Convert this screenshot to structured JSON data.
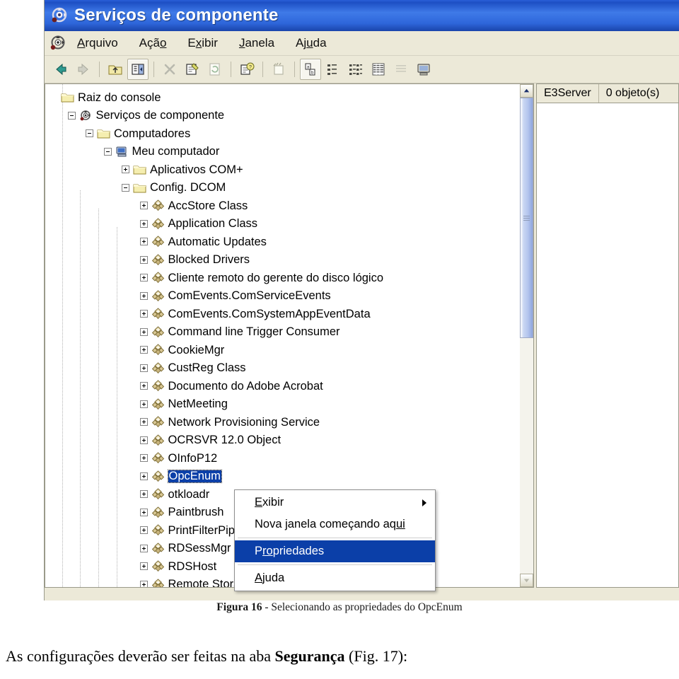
{
  "window": {
    "title": "Serviços de componente",
    "title_icon": "component-services-icon",
    "menu_icon": "component-services-icon"
  },
  "menubar": {
    "items": [
      {
        "name": "menu-arquivo",
        "pre": "",
        "acc": "A",
        "post": "rquivo"
      },
      {
        "name": "menu-acao",
        "pre": "Açã",
        "acc": "o",
        "post": ""
      },
      {
        "name": "menu-exibir",
        "pre": "E",
        "acc": "x",
        "post": "ibir"
      },
      {
        "name": "menu-janela",
        "pre": "",
        "acc": "J",
        "post": "anela"
      },
      {
        "name": "menu-ajuda",
        "pre": "Aj",
        "acc": "u",
        "post": "da"
      }
    ]
  },
  "toolbar": {
    "buttons": [
      {
        "name": "back-icon",
        "glyph": "back"
      },
      {
        "name": "forward-icon",
        "glyph": "forward"
      },
      {
        "name": "sep",
        "glyph": "sep"
      },
      {
        "name": "up-one-level-icon",
        "glyph": "up-folder"
      },
      {
        "name": "show-hide-console-tree-icon",
        "glyph": "tree-pane",
        "pressed": true
      },
      {
        "name": "sep",
        "glyph": "sep"
      },
      {
        "name": "delete-icon",
        "glyph": "delete"
      },
      {
        "name": "properties-icon",
        "glyph": "properties"
      },
      {
        "name": "refresh-icon",
        "glyph": "refresh"
      },
      {
        "name": "sep",
        "glyph": "sep"
      },
      {
        "name": "help-icon",
        "glyph": "help"
      },
      {
        "name": "sep",
        "glyph": "sep"
      },
      {
        "name": "new-object-icon",
        "glyph": "new-object"
      },
      {
        "name": "sep",
        "glyph": "sep"
      },
      {
        "name": "large-icons-view-icon",
        "glyph": "large-icons",
        "pressed": true
      },
      {
        "name": "small-icons-view-icon",
        "glyph": "small-icons"
      },
      {
        "name": "list-view-icon",
        "glyph": "list-view"
      },
      {
        "name": "detail-view-icon",
        "glyph": "detail-view"
      },
      {
        "name": "report-view-icon",
        "glyph": "report-view"
      },
      {
        "name": "computer-view-icon",
        "glyph": "computer-view"
      }
    ]
  },
  "tree": {
    "items": [
      {
        "label": "Raiz do console",
        "indent": 0,
        "expander": "none",
        "icon": "folder-icon"
      },
      {
        "label": "Serviços de componente",
        "indent": 1,
        "expander": "minus",
        "icon": "component-services-icon"
      },
      {
        "label": "Computadores",
        "indent": 2,
        "expander": "minus",
        "icon": "folder-icon"
      },
      {
        "label": "Meu computador",
        "indent": 3,
        "expander": "minus",
        "icon": "computer-icon"
      },
      {
        "label": "Aplicativos COM+",
        "indent": 4,
        "expander": "plus",
        "icon": "folder-icon"
      },
      {
        "label": "Config. DCOM",
        "indent": 4,
        "expander": "minus",
        "icon": "folder-icon"
      },
      {
        "label": "AccStore Class",
        "indent": 5,
        "expander": "plus",
        "icon": "dcom-object-icon"
      },
      {
        "label": "Application Class",
        "indent": 5,
        "expander": "plus",
        "icon": "dcom-object-icon"
      },
      {
        "label": "Automatic Updates",
        "indent": 5,
        "expander": "plus",
        "icon": "dcom-object-icon"
      },
      {
        "label": "Blocked Drivers",
        "indent": 5,
        "expander": "plus",
        "icon": "dcom-object-icon"
      },
      {
        "label": "Cliente remoto do gerente do disco lógico",
        "indent": 5,
        "expander": "plus",
        "icon": "dcom-object-icon"
      },
      {
        "label": "ComEvents.ComServiceEvents",
        "indent": 5,
        "expander": "plus",
        "icon": "dcom-object-icon"
      },
      {
        "label": "ComEvents.ComSystemAppEventData",
        "indent": 5,
        "expander": "plus",
        "icon": "dcom-object-icon"
      },
      {
        "label": "Command line Trigger Consumer",
        "indent": 5,
        "expander": "plus",
        "icon": "dcom-object-icon"
      },
      {
        "label": "CookieMgr",
        "indent": 5,
        "expander": "plus",
        "icon": "dcom-object-icon"
      },
      {
        "label": "CustReg Class",
        "indent": 5,
        "expander": "plus",
        "icon": "dcom-object-icon"
      },
      {
        "label": "Documento do Adobe Acrobat",
        "indent": 5,
        "expander": "plus",
        "icon": "dcom-object-icon"
      },
      {
        "label": "NetMeeting",
        "indent": 5,
        "expander": "plus",
        "icon": "dcom-object-icon"
      },
      {
        "label": "Network Provisioning Service",
        "indent": 5,
        "expander": "plus",
        "icon": "dcom-object-icon"
      },
      {
        "label": "OCRSVR 12.0 Object",
        "indent": 5,
        "expander": "plus",
        "icon": "dcom-object-icon"
      },
      {
        "label": "OInfoP12",
        "indent": 5,
        "expander": "plus",
        "icon": "dcom-object-icon"
      },
      {
        "label": "OpcEnum",
        "indent": 5,
        "expander": "plus",
        "icon": "dcom-object-icon",
        "selected": true
      },
      {
        "label": "otkloadr",
        "indent": 5,
        "expander": "plus",
        "icon": "dcom-object-icon"
      },
      {
        "label": "Paintbrush",
        "indent": 5,
        "expander": "plus",
        "icon": "dcom-object-icon"
      },
      {
        "label": "PrintFilterPipelineSvc",
        "indent": 5,
        "expander": "plus",
        "icon": "dcom-object-icon"
      },
      {
        "label": "RDSessMgr",
        "indent": 5,
        "expander": "plus",
        "icon": "dcom-object-icon"
      },
      {
        "label": "RDSHost",
        "indent": 5,
        "expander": "plus",
        "icon": "dcom-object-icon"
      },
      {
        "label": "Remote Storage",
        "indent": 5,
        "expander": "plus",
        "icon": "dcom-object-icon"
      }
    ]
  },
  "right_pane": {
    "columns": [
      "E3Server",
      "0 objeto(s)"
    ]
  },
  "context_menu": {
    "items": [
      {
        "type": "item",
        "name": "ctx-exibir",
        "pre": "",
        "acc": "E",
        "post": "xibir",
        "submenu": true
      },
      {
        "type": "item",
        "name": "ctx-nova-janela",
        "pre": "Nova janela começando aq",
        "acc": "ui",
        "post": "",
        "submenu": false
      },
      {
        "type": "separator"
      },
      {
        "type": "item",
        "name": "ctx-propriedades",
        "pre": "P",
        "acc": "ro",
        "post": "priedades",
        "highlighted": true,
        "submenu": false
      },
      {
        "type": "separator"
      },
      {
        "type": "item",
        "name": "ctx-ajuda",
        "pre": "",
        "acc": "A",
        "post": "juda",
        "submenu": false
      }
    ]
  },
  "document": {
    "caption_label": "Figura 16",
    "caption_text": " - Selecionando as propriedades do OpcEnum",
    "body_pre": "As configurações deverão ser feitas na aba ",
    "body_bold": "Segurança",
    "body_post": " (Fig. 17):"
  },
  "colors": {
    "title_bar": "#2a5fd8",
    "selection": "#0b3fa8",
    "face": "#ece9d8"
  }
}
